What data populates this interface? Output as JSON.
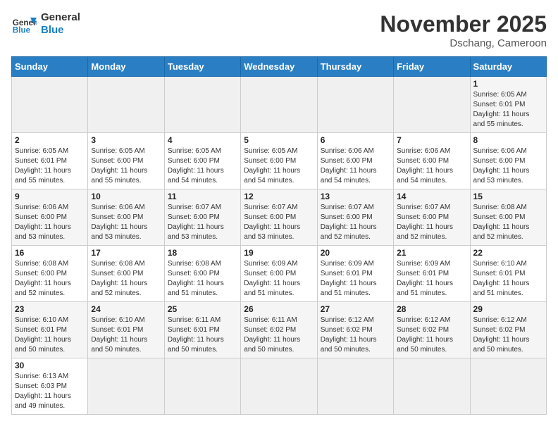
{
  "header": {
    "logo_general": "General",
    "logo_blue": "Blue",
    "month_title": "November 2025",
    "location": "Dschang, Cameroon"
  },
  "days_of_week": [
    "Sunday",
    "Monday",
    "Tuesday",
    "Wednesday",
    "Thursday",
    "Friday",
    "Saturday"
  ],
  "weeks": [
    [
      {
        "day": "",
        "info": ""
      },
      {
        "day": "",
        "info": ""
      },
      {
        "day": "",
        "info": ""
      },
      {
        "day": "",
        "info": ""
      },
      {
        "day": "",
        "info": ""
      },
      {
        "day": "",
        "info": ""
      },
      {
        "day": "1",
        "info": "Sunrise: 6:05 AM\nSunset: 6:01 PM\nDaylight: 11 hours\nand 55 minutes."
      }
    ],
    [
      {
        "day": "2",
        "info": "Sunrise: 6:05 AM\nSunset: 6:01 PM\nDaylight: 11 hours\nand 55 minutes."
      },
      {
        "day": "3",
        "info": "Sunrise: 6:05 AM\nSunset: 6:00 PM\nDaylight: 11 hours\nand 55 minutes."
      },
      {
        "day": "4",
        "info": "Sunrise: 6:05 AM\nSunset: 6:00 PM\nDaylight: 11 hours\nand 54 minutes."
      },
      {
        "day": "5",
        "info": "Sunrise: 6:05 AM\nSunset: 6:00 PM\nDaylight: 11 hours\nand 54 minutes."
      },
      {
        "day": "6",
        "info": "Sunrise: 6:06 AM\nSunset: 6:00 PM\nDaylight: 11 hours\nand 54 minutes."
      },
      {
        "day": "7",
        "info": "Sunrise: 6:06 AM\nSunset: 6:00 PM\nDaylight: 11 hours\nand 54 minutes."
      },
      {
        "day": "8",
        "info": "Sunrise: 6:06 AM\nSunset: 6:00 PM\nDaylight: 11 hours\nand 53 minutes."
      }
    ],
    [
      {
        "day": "9",
        "info": "Sunrise: 6:06 AM\nSunset: 6:00 PM\nDaylight: 11 hours\nand 53 minutes."
      },
      {
        "day": "10",
        "info": "Sunrise: 6:06 AM\nSunset: 6:00 PM\nDaylight: 11 hours\nand 53 minutes."
      },
      {
        "day": "11",
        "info": "Sunrise: 6:07 AM\nSunset: 6:00 PM\nDaylight: 11 hours\nand 53 minutes."
      },
      {
        "day": "12",
        "info": "Sunrise: 6:07 AM\nSunset: 6:00 PM\nDaylight: 11 hours\nand 53 minutes."
      },
      {
        "day": "13",
        "info": "Sunrise: 6:07 AM\nSunset: 6:00 PM\nDaylight: 11 hours\nand 52 minutes."
      },
      {
        "day": "14",
        "info": "Sunrise: 6:07 AM\nSunset: 6:00 PM\nDaylight: 11 hours\nand 52 minutes."
      },
      {
        "day": "15",
        "info": "Sunrise: 6:08 AM\nSunset: 6:00 PM\nDaylight: 11 hours\nand 52 minutes."
      }
    ],
    [
      {
        "day": "16",
        "info": "Sunrise: 6:08 AM\nSunset: 6:00 PM\nDaylight: 11 hours\nand 52 minutes."
      },
      {
        "day": "17",
        "info": "Sunrise: 6:08 AM\nSunset: 6:00 PM\nDaylight: 11 hours\nand 52 minutes."
      },
      {
        "day": "18",
        "info": "Sunrise: 6:08 AM\nSunset: 6:00 PM\nDaylight: 11 hours\nand 51 minutes."
      },
      {
        "day": "19",
        "info": "Sunrise: 6:09 AM\nSunset: 6:00 PM\nDaylight: 11 hours\nand 51 minutes."
      },
      {
        "day": "20",
        "info": "Sunrise: 6:09 AM\nSunset: 6:01 PM\nDaylight: 11 hours\nand 51 minutes."
      },
      {
        "day": "21",
        "info": "Sunrise: 6:09 AM\nSunset: 6:01 PM\nDaylight: 11 hours\nand 51 minutes."
      },
      {
        "day": "22",
        "info": "Sunrise: 6:10 AM\nSunset: 6:01 PM\nDaylight: 11 hours\nand 51 minutes."
      }
    ],
    [
      {
        "day": "23",
        "info": "Sunrise: 6:10 AM\nSunset: 6:01 PM\nDaylight: 11 hours\nand 50 minutes."
      },
      {
        "day": "24",
        "info": "Sunrise: 6:10 AM\nSunset: 6:01 PM\nDaylight: 11 hours\nand 50 minutes."
      },
      {
        "day": "25",
        "info": "Sunrise: 6:11 AM\nSunset: 6:01 PM\nDaylight: 11 hours\nand 50 minutes."
      },
      {
        "day": "26",
        "info": "Sunrise: 6:11 AM\nSunset: 6:02 PM\nDaylight: 11 hours\nand 50 minutes."
      },
      {
        "day": "27",
        "info": "Sunrise: 6:12 AM\nSunset: 6:02 PM\nDaylight: 11 hours\nand 50 minutes."
      },
      {
        "day": "28",
        "info": "Sunrise: 6:12 AM\nSunset: 6:02 PM\nDaylight: 11 hours\nand 50 minutes."
      },
      {
        "day": "29",
        "info": "Sunrise: 6:12 AM\nSunset: 6:02 PM\nDaylight: 11 hours\nand 50 minutes."
      }
    ],
    [
      {
        "day": "30",
        "info": "Sunrise: 6:13 AM\nSunset: 6:03 PM\nDaylight: 11 hours\nand 49 minutes."
      },
      {
        "day": "",
        "info": ""
      },
      {
        "day": "",
        "info": ""
      },
      {
        "day": "",
        "info": ""
      },
      {
        "day": "",
        "info": ""
      },
      {
        "day": "",
        "info": ""
      },
      {
        "day": "",
        "info": ""
      }
    ]
  ]
}
